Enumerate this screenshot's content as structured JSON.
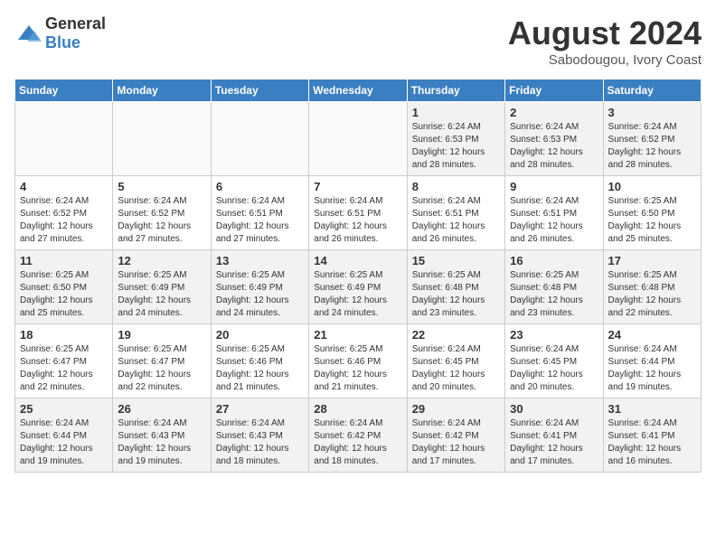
{
  "header": {
    "logo_general": "General",
    "logo_blue": "Blue",
    "month_year": "August 2024",
    "location": "Sabodougou, Ivory Coast"
  },
  "days_of_week": [
    "Sunday",
    "Monday",
    "Tuesday",
    "Wednesday",
    "Thursday",
    "Friday",
    "Saturday"
  ],
  "weeks": [
    [
      {
        "day": "",
        "info": ""
      },
      {
        "day": "",
        "info": ""
      },
      {
        "day": "",
        "info": ""
      },
      {
        "day": "",
        "info": ""
      },
      {
        "day": "1",
        "info": "Sunrise: 6:24 AM\nSunset: 6:53 PM\nDaylight: 12 hours\nand 28 minutes."
      },
      {
        "day": "2",
        "info": "Sunrise: 6:24 AM\nSunset: 6:53 PM\nDaylight: 12 hours\nand 28 minutes."
      },
      {
        "day": "3",
        "info": "Sunrise: 6:24 AM\nSunset: 6:52 PM\nDaylight: 12 hours\nand 28 minutes."
      }
    ],
    [
      {
        "day": "4",
        "info": "Sunrise: 6:24 AM\nSunset: 6:52 PM\nDaylight: 12 hours\nand 27 minutes."
      },
      {
        "day": "5",
        "info": "Sunrise: 6:24 AM\nSunset: 6:52 PM\nDaylight: 12 hours\nand 27 minutes."
      },
      {
        "day": "6",
        "info": "Sunrise: 6:24 AM\nSunset: 6:51 PM\nDaylight: 12 hours\nand 27 minutes."
      },
      {
        "day": "7",
        "info": "Sunrise: 6:24 AM\nSunset: 6:51 PM\nDaylight: 12 hours\nand 26 minutes."
      },
      {
        "day": "8",
        "info": "Sunrise: 6:24 AM\nSunset: 6:51 PM\nDaylight: 12 hours\nand 26 minutes."
      },
      {
        "day": "9",
        "info": "Sunrise: 6:24 AM\nSunset: 6:51 PM\nDaylight: 12 hours\nand 26 minutes."
      },
      {
        "day": "10",
        "info": "Sunrise: 6:25 AM\nSunset: 6:50 PM\nDaylight: 12 hours\nand 25 minutes."
      }
    ],
    [
      {
        "day": "11",
        "info": "Sunrise: 6:25 AM\nSunset: 6:50 PM\nDaylight: 12 hours\nand 25 minutes."
      },
      {
        "day": "12",
        "info": "Sunrise: 6:25 AM\nSunset: 6:49 PM\nDaylight: 12 hours\nand 24 minutes."
      },
      {
        "day": "13",
        "info": "Sunrise: 6:25 AM\nSunset: 6:49 PM\nDaylight: 12 hours\nand 24 minutes."
      },
      {
        "day": "14",
        "info": "Sunrise: 6:25 AM\nSunset: 6:49 PM\nDaylight: 12 hours\nand 24 minutes."
      },
      {
        "day": "15",
        "info": "Sunrise: 6:25 AM\nSunset: 6:48 PM\nDaylight: 12 hours\nand 23 minutes."
      },
      {
        "day": "16",
        "info": "Sunrise: 6:25 AM\nSunset: 6:48 PM\nDaylight: 12 hours\nand 23 minutes."
      },
      {
        "day": "17",
        "info": "Sunrise: 6:25 AM\nSunset: 6:48 PM\nDaylight: 12 hours\nand 22 minutes."
      }
    ],
    [
      {
        "day": "18",
        "info": "Sunrise: 6:25 AM\nSunset: 6:47 PM\nDaylight: 12 hours\nand 22 minutes."
      },
      {
        "day": "19",
        "info": "Sunrise: 6:25 AM\nSunset: 6:47 PM\nDaylight: 12 hours\nand 22 minutes."
      },
      {
        "day": "20",
        "info": "Sunrise: 6:25 AM\nSunset: 6:46 PM\nDaylight: 12 hours\nand 21 minutes."
      },
      {
        "day": "21",
        "info": "Sunrise: 6:25 AM\nSunset: 6:46 PM\nDaylight: 12 hours\nand 21 minutes."
      },
      {
        "day": "22",
        "info": "Sunrise: 6:24 AM\nSunset: 6:45 PM\nDaylight: 12 hours\nand 20 minutes."
      },
      {
        "day": "23",
        "info": "Sunrise: 6:24 AM\nSunset: 6:45 PM\nDaylight: 12 hours\nand 20 minutes."
      },
      {
        "day": "24",
        "info": "Sunrise: 6:24 AM\nSunset: 6:44 PM\nDaylight: 12 hours\nand 19 minutes."
      }
    ],
    [
      {
        "day": "25",
        "info": "Sunrise: 6:24 AM\nSunset: 6:44 PM\nDaylight: 12 hours\nand 19 minutes."
      },
      {
        "day": "26",
        "info": "Sunrise: 6:24 AM\nSunset: 6:43 PM\nDaylight: 12 hours\nand 19 minutes."
      },
      {
        "day": "27",
        "info": "Sunrise: 6:24 AM\nSunset: 6:43 PM\nDaylight: 12 hours\nand 18 minutes."
      },
      {
        "day": "28",
        "info": "Sunrise: 6:24 AM\nSunset: 6:42 PM\nDaylight: 12 hours\nand 18 minutes."
      },
      {
        "day": "29",
        "info": "Sunrise: 6:24 AM\nSunset: 6:42 PM\nDaylight: 12 hours\nand 17 minutes."
      },
      {
        "day": "30",
        "info": "Sunrise: 6:24 AM\nSunset: 6:41 PM\nDaylight: 12 hours\nand 17 minutes."
      },
      {
        "day": "31",
        "info": "Sunrise: 6:24 AM\nSunset: 6:41 PM\nDaylight: 12 hours\nand 16 minutes."
      }
    ]
  ]
}
